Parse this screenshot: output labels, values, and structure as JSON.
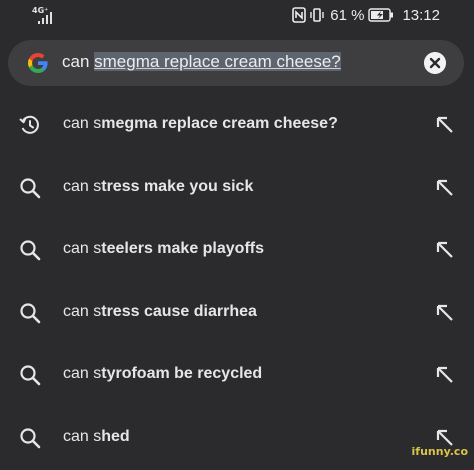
{
  "status_bar": {
    "network_type": "4G⁺",
    "battery_percent": "61 %",
    "time": "13:12"
  },
  "search": {
    "query_prefix": "can ",
    "query_selected": "smegma replace cream cheese?",
    "logo": "google-g-logo",
    "clear_icon": "close-icon"
  },
  "suggestions": [
    {
      "icon": "history-icon",
      "typed": "can s",
      "rest": "megma replace cream cheese?"
    },
    {
      "icon": "search-icon",
      "typed": "can s",
      "rest": "tress make you sick"
    },
    {
      "icon": "search-icon",
      "typed": "can s",
      "rest": "teelers make playoffs"
    },
    {
      "icon": "search-icon",
      "typed": "can s",
      "rest": "tress cause diarrhea"
    },
    {
      "icon": "search-icon",
      "typed": "can s",
      "rest": "tyrofoam be recycled"
    },
    {
      "icon": "search-icon",
      "typed": "can s",
      "rest": "hed"
    }
  ],
  "watermark": "ifunny.co",
  "colors": {
    "background": "#2b2b2d",
    "search_bar": "#3e3e41",
    "selection": "#5d6470",
    "text": "#e6e6e6"
  }
}
